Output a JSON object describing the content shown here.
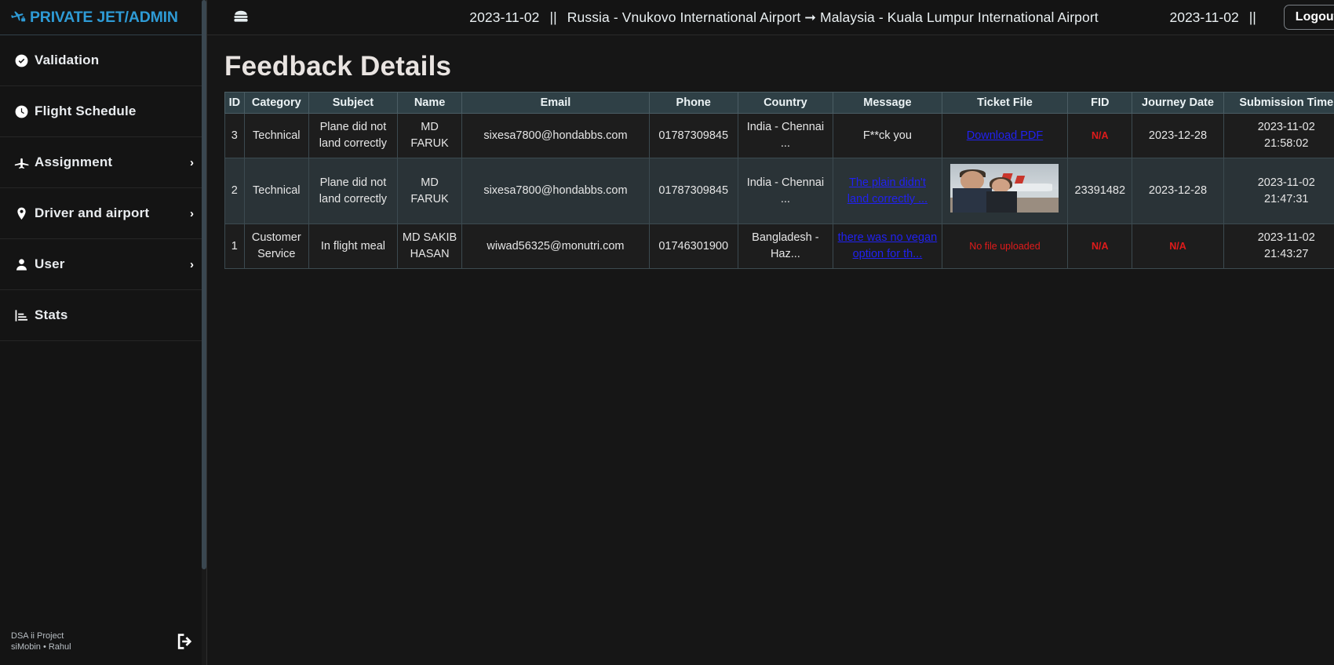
{
  "sidebar": {
    "brand": "PRIVATE JET/ADMIN",
    "brand_icon": "plane-lock-icon",
    "items": [
      {
        "label": "Validation",
        "icon": "check-circle-icon",
        "caret": "",
        "has_caret": false
      },
      {
        "label": "Flight Schedule",
        "icon": "clock-icon",
        "caret": "",
        "has_caret": false
      },
      {
        "label": "Assignment",
        "icon": "plane-icon",
        "caret": "›",
        "has_caret": true
      },
      {
        "label": "Driver and airport",
        "icon": "map-pin-icon",
        "caret": "›",
        "has_caret": true
      },
      {
        "label": "User",
        "icon": "user-icon",
        "caret": "›",
        "has_caret": true
      },
      {
        "label": "Stats",
        "icon": "bar-chart-icon",
        "caret": "",
        "has_caret": false
      }
    ],
    "footer": {
      "project": "DSA ii Project",
      "authors": "siMobin  •  Rahul",
      "logout_icon": "logout-icon"
    }
  },
  "topbar": {
    "menu_icon": "hamburger-icon",
    "route_date": "2023-11-02",
    "route_separator": "||",
    "route": "Russia - Vnukovo International Airport ➞ Malaysia - Kuala Lumpur International Airport",
    "right_date": "2023-11-02",
    "right_separator": "||",
    "logout_label": "Logout"
  },
  "page": {
    "title": "Feedback Details"
  },
  "table": {
    "columns": [
      "ID",
      "Category",
      "Subject",
      "Name",
      "Email",
      "Phone",
      "Country",
      "Message",
      "Ticket File",
      "FID",
      "Journey Date",
      "Submission Time"
    ],
    "rows": [
      {
        "id": "3",
        "category": "Technical",
        "subject": "Plane did not land correctly",
        "name": "MD FARUK",
        "email": "sixesa7800@hondabbs.com",
        "phone": "01787309845",
        "country": "India - Chennai ...",
        "message": "F**ck you",
        "message_is_link": false,
        "ticket_file": "Download PDF",
        "ticket_file_type": "link",
        "fid": "N/A",
        "fid_is_na": true,
        "journey_date": "2023-12-28",
        "journey_date_is_na": false,
        "submission_date": "2023-11-02",
        "submission_time": "21:58:02"
      },
      {
        "id": "2",
        "category": "Technical",
        "subject": "Plane did not land correctly",
        "name": "MD FARUK",
        "email": "sixesa7800@hondabbs.com",
        "phone": "01787309845",
        "country": "India - Chennai ...",
        "message": "The plain didn't land correctly ...",
        "message_is_link": true,
        "ticket_file": "",
        "ticket_file_type": "image",
        "fid": "23391482",
        "fid_is_na": false,
        "journey_date": "2023-12-28",
        "journey_date_is_na": false,
        "submission_date": "2023-11-02",
        "submission_time": "21:47:31"
      },
      {
        "id": "1",
        "category": "Customer Service",
        "subject": "In flight meal",
        "name": "MD SAKIB HASAN",
        "email": "wiwad56325@monutri.com",
        "phone": "01746301900",
        "country": "Bangladesh - Haz...",
        "message": "there was no vegan option for th...",
        "message_is_link": true,
        "ticket_file": "No file uploaded",
        "ticket_file_type": "none",
        "fid": "N/A",
        "fid_is_na": true,
        "journey_date": "N/A",
        "journey_date_is_na": true,
        "submission_date": "2023-11-02",
        "submission_time": "21:43:27"
      }
    ]
  },
  "colors": {
    "brand": "#2e9bd6",
    "table_header_bg": "#2f4046",
    "row_odd_bg": "#1d1d1d",
    "row_even_bg": "#2a3337",
    "link": "#2121f0",
    "danger": "#e01b1b"
  }
}
